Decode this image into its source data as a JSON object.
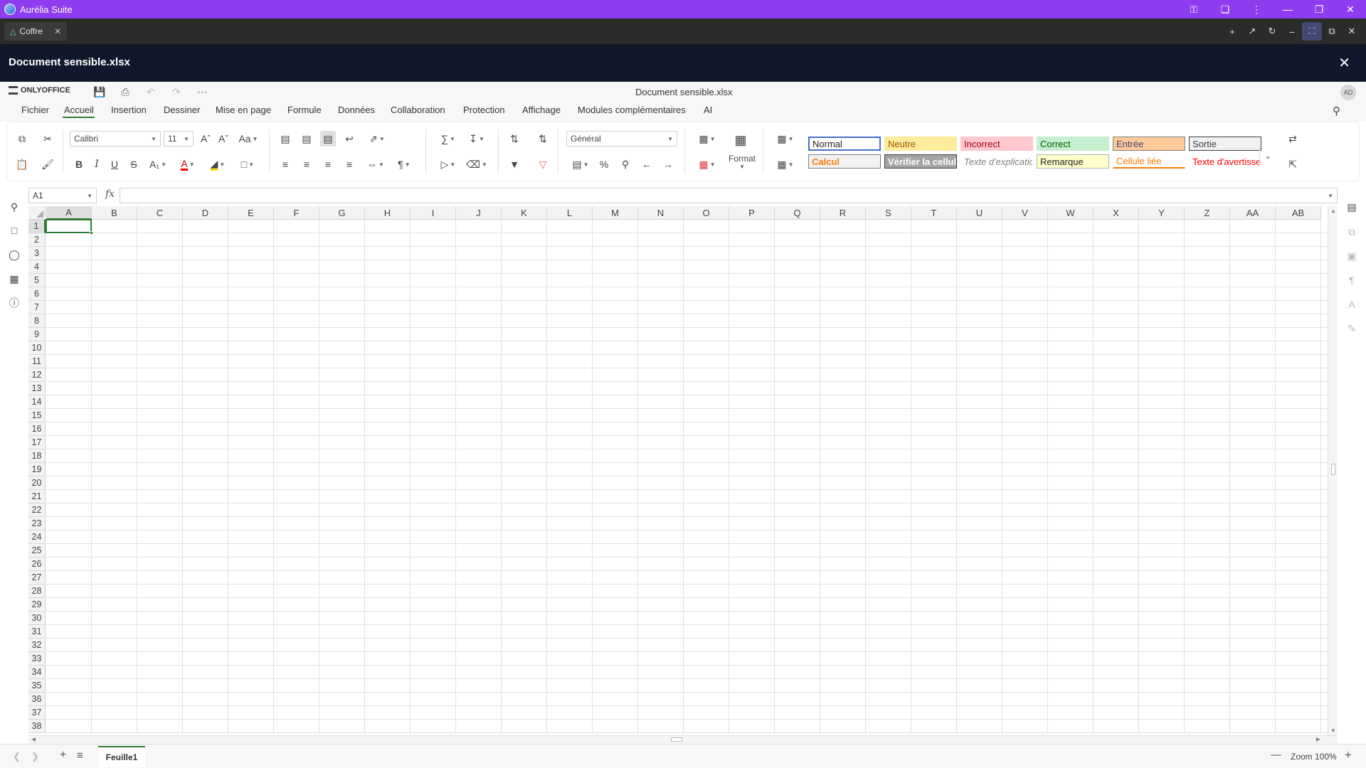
{
  "app": {
    "title": "Aurélia Suite"
  },
  "tab": {
    "label": "Coffre"
  },
  "doc_header": {
    "title": "Document sensible.xlsx"
  },
  "editor": {
    "brand": "ONLYOFFICE",
    "document_name": "Document sensible.xlsx",
    "avatar": "AD"
  },
  "menu": [
    "Fichier",
    "Accueil",
    "Insertion",
    "Dessiner",
    "Mise en page",
    "Formule",
    "Données",
    "Collaboration",
    "Protection",
    "Affichage",
    "Modules complémentaires",
    "AI"
  ],
  "toolbar": {
    "font_name": "Calibri",
    "font_size": "11",
    "number_format": "Général",
    "format_label": "Format"
  },
  "styles": [
    {
      "label": "Normal",
      "color": "#222222",
      "bg": "#ffffff",
      "border": "#4472c4"
    },
    {
      "label": "Neutre",
      "color": "#9c5700",
      "bg": "#ffeb9c",
      "border": "#ffeb9c"
    },
    {
      "label": "Incorrect",
      "color": "#9c0006",
      "bg": "#ffc7ce",
      "border": "#ffc7ce"
    },
    {
      "label": "Correct",
      "color": "#006100",
      "bg": "#c6efce",
      "border": "#c6efce"
    },
    {
      "label": "Entrée",
      "color": "#3f3f76",
      "bg": "#ffcc99",
      "border": "#7f7f7f"
    },
    {
      "label": "Sortie",
      "color": "#3f3f3f",
      "bg": "#f2f2f2",
      "border": "#3f3f3f"
    },
    {
      "label": "Calcul",
      "color": "#fa7d00",
      "bg": "#f2f2f2",
      "border": "#7f7f7f"
    },
    {
      "label": "Vérifier la cellule",
      "color": "#ffffff",
      "bg": "#a5a5a5",
      "border": "#3f3f3f"
    },
    {
      "label": "Texte d'explication",
      "color": "#7f7f7f",
      "bg": "#ffffff",
      "border": "#ffffff"
    },
    {
      "label": "Remarque",
      "color": "#222222",
      "bg": "#ffffcc",
      "border": "#b2b2b2"
    },
    {
      "label": "Cellule liée",
      "color": "#fa7d00",
      "bg": "#ffffff",
      "border": "#ffffff"
    },
    {
      "label": "Texte d'avertissement",
      "color": "#ff0000",
      "bg": "#ffffff",
      "border": "#ffffff"
    }
  ],
  "formula_bar": {
    "name_box": "A1",
    "fx": "fx",
    "formula": ""
  },
  "grid": {
    "columns": [
      "A",
      "B",
      "C",
      "D",
      "E",
      "F",
      "G",
      "H",
      "I",
      "J",
      "K",
      "L",
      "M",
      "N",
      "O",
      "P",
      "Q",
      "R",
      "S",
      "T",
      "U",
      "V",
      "W",
      "X",
      "Y",
      "Z",
      "AA",
      "AB"
    ],
    "rows": [
      "1",
      "2",
      "3",
      "4",
      "5",
      "6",
      "7",
      "8",
      "9",
      "10",
      "11",
      "12",
      "13",
      "14",
      "15",
      "16",
      "17",
      "18",
      "19",
      "20",
      "21",
      "22",
      "23",
      "24",
      "25",
      "26",
      "27",
      "28",
      "29",
      "30",
      "31",
      "32",
      "33",
      "34",
      "35",
      "36",
      "37",
      "38"
    ]
  },
  "statusbar": {
    "sheet_tab": "Feuille1",
    "zoom": "Zoom 100%"
  },
  "colors": {
    "titlebar": "#8d3cf0",
    "tabbar": "#2b2b2b",
    "doc_header": "#12182b",
    "accent": "#2e7d32"
  }
}
